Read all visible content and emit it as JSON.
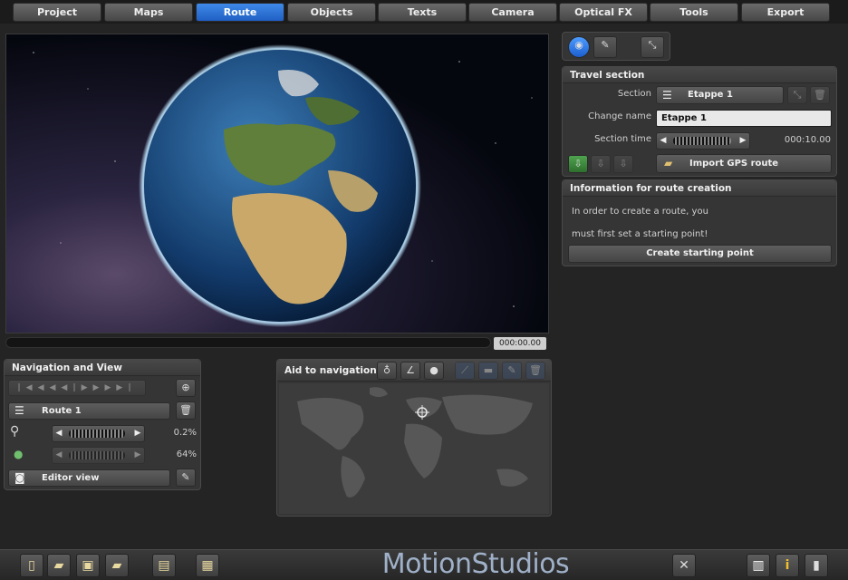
{
  "tabs": [
    "Project",
    "Maps",
    "Route",
    "Objects",
    "Texts",
    "Camera",
    "Optical FX",
    "Tools",
    "Export"
  ],
  "active_tab": "Route",
  "viewport": {
    "timecode": "000:00.00"
  },
  "travel_section": {
    "title": "Travel section",
    "section_label": "Section",
    "section_value": "Etappe 1",
    "change_name_label": "Change name",
    "change_name_value": "Etappe 1",
    "section_time_label": "Section time",
    "section_time_value": "000:10.00",
    "import_gps_label": "Import GPS route"
  },
  "info_route": {
    "title": "Information for route creation",
    "line1": "In order to create a route, you",
    "line2": "must first set a starting point!",
    "create_button": "Create starting point"
  },
  "navigation": {
    "title": "Navigation and View",
    "route_value": "Route 1",
    "zoom_value": "0.2%",
    "second_value": "64%",
    "view_value": "Editor view"
  },
  "aid": {
    "title": "Aid to navigation"
  },
  "brand": {
    "logo": "MotionStudios"
  },
  "icons": [
    "document-icon",
    "open-folder-icon",
    "save-icon",
    "save-as-icon",
    "image-export-icon",
    "film-icon",
    "tools-icon",
    "book-icon",
    "info-icon",
    "trash-icon"
  ]
}
